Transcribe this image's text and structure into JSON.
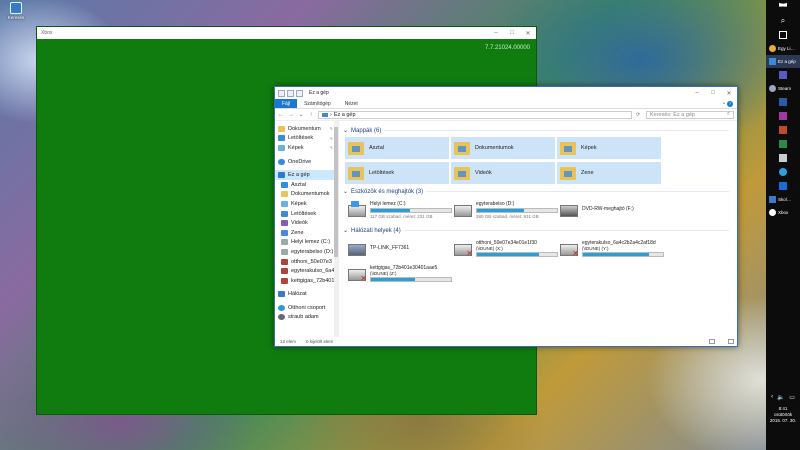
{
  "desktop": {
    "icon_label": "Keresés"
  },
  "xbox": {
    "title": "Xbox",
    "version": "7.7.21024.00000"
  },
  "explorer": {
    "title": "Ez a gép",
    "tabs": [
      "Fájl",
      "Számítógép",
      "Nézet"
    ],
    "address": "Ez a gép",
    "search_placeholder": "Keresés: Ez a gép",
    "nav": [
      {
        "label": "Dokumentum",
        "icon": "folder-icon",
        "pinned": true
      },
      {
        "label": "Letöltések",
        "icon": "download-icon",
        "pinned": true
      },
      {
        "label": "Képek",
        "icon": "pictures-icon",
        "pinned": true
      },
      {
        "label": "OneDrive",
        "icon": "onedrive-icon",
        "gap": true
      },
      {
        "label": "Ez a gép",
        "icon": "this-pc-icon",
        "selected": true,
        "gap": true
      },
      {
        "label": "Asztal",
        "icon": "desktop-icon"
      },
      {
        "label": "Dokumentumok",
        "icon": "folder-icon"
      },
      {
        "label": "Képek",
        "icon": "pictures-icon"
      },
      {
        "label": "Letöltések",
        "icon": "download-icon"
      },
      {
        "label": "Videók",
        "icon": "video-icon"
      },
      {
        "label": "Zene",
        "icon": "music-icon"
      },
      {
        "label": "Helyi lemez (C:)",
        "icon": "drive-icon"
      },
      {
        "label": "egyterabelso (D:)",
        "icon": "drive-icon"
      },
      {
        "label": "otthoni_50e07e3",
        "icon": "network-drive-icon"
      },
      {
        "label": "egyterakulso_6a4",
        "icon": "network-drive-icon"
      },
      {
        "label": "kettgigas_72b401",
        "icon": "network-drive-icon"
      },
      {
        "label": "Hálózat",
        "icon": "network-icon",
        "gap": true
      },
      {
        "label": "Otthoni csoport",
        "icon": "homegroup-icon",
        "gap": true
      },
      {
        "label": "straub adam",
        "icon": "user-icon"
      }
    ],
    "folders_header": "Mappák (6)",
    "folders": [
      {
        "label": "Asztal"
      },
      {
        "label": "Dokumentumok"
      },
      {
        "label": "Képek"
      },
      {
        "label": "Letöltések"
      },
      {
        "label": "Videók"
      },
      {
        "label": "Zene"
      }
    ],
    "devices_header": "Eszközök és meghajtók (3)",
    "devices": [
      {
        "name": "Helyi lemez (C:)",
        "free": "117 GB szabad, méret: 231 GB",
        "used": 0.49
      },
      {
        "name": "egyterabelso (D:)",
        "free": "380 GB szabad, méret: 931 GB",
        "used": 0.59
      },
      {
        "name": "DVD-RW-meghajtó (F:)"
      }
    ],
    "network_header": "Hálózati helyek (4)",
    "network": [
      {
        "name": "TP-LINK_FF7361"
      },
      {
        "name": "otthoni_50e07e34e01e1f30",
        "sub": "(\\\\DUNE) (X:)",
        "used": 0.78
      },
      {
        "name": "egyterakulso_6a4c2b2a4c2af18d",
        "sub": "(\\\\DUNE) (Y:)",
        "used": 0.82
      },
      {
        "name": "kettgigas_72b401e30401aae5",
        "sub": "(\\\\DUNE) (Z:)",
        "used": 0.55
      }
    ],
    "status_items": "12 elem",
    "status_selected": "0 kijelölt elem"
  },
  "taskbar": {
    "apps": [
      "Egy Li…",
      "Ez a gép",
      "Steam",
      "Skol…",
      "Xbox"
    ],
    "time": "8:41",
    "day": "csütörtök",
    "date": "2015. 07. 30."
  }
}
